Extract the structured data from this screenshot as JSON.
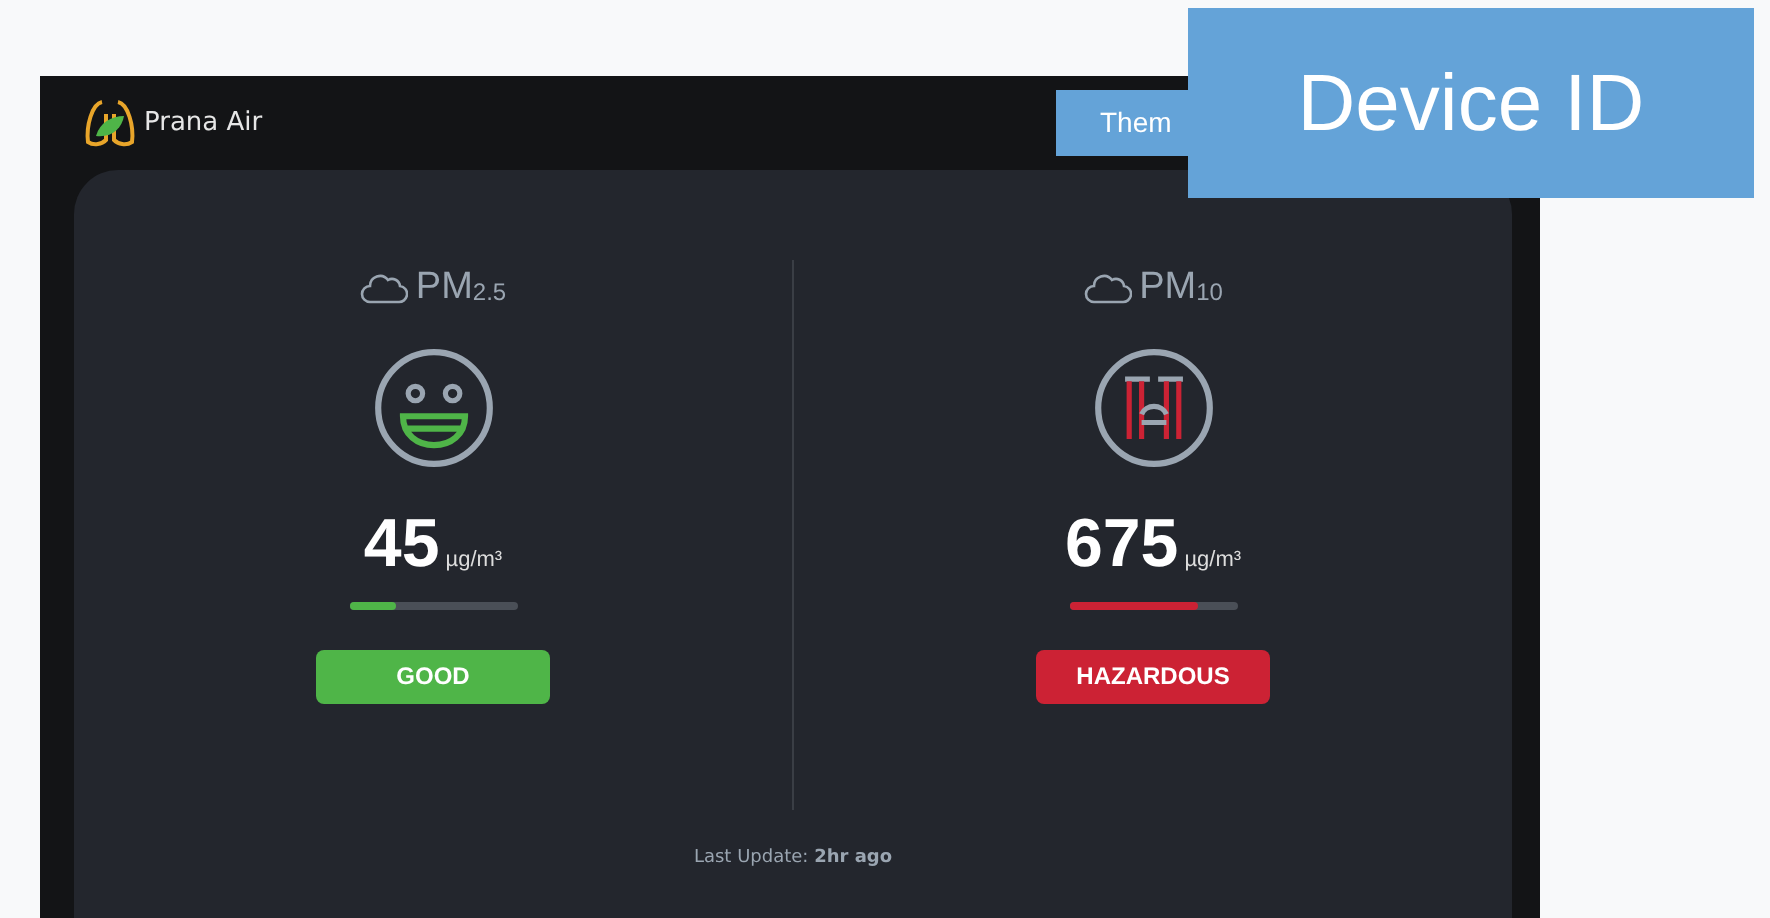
{
  "brand": {
    "name": "Prana Air"
  },
  "theme_button": {
    "label": "Them"
  },
  "device_id": {
    "label": "Device ID"
  },
  "readings": [
    {
      "label": "PM",
      "subscript": "2.5",
      "kind": "happy",
      "value": "45",
      "unit": "µg/m³",
      "level": 0.28,
      "color": "#4fb548",
      "status": "GOOD"
    },
    {
      "label": "PM",
      "subscript": "10",
      "kind": "hazardous",
      "value": "675",
      "unit": "µg/m³",
      "level": 0.77,
      "color": "#cc2234",
      "status": "HAZARDOUS"
    }
  ],
  "last_update": {
    "label": "Last Update:",
    "value": "2hr ago"
  }
}
